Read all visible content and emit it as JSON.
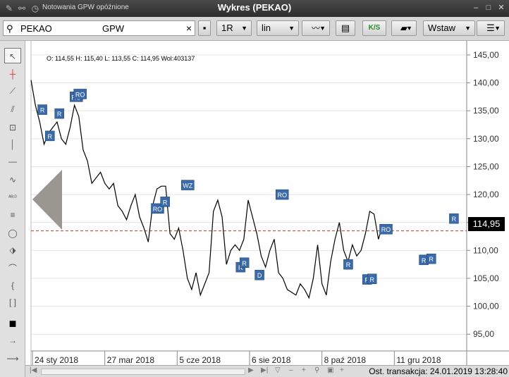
{
  "window": {
    "app_title": "Notowania GPW opóźnione",
    "title": "Wykres (PEKAO)"
  },
  "toolbar": {
    "symbol": "PEKAO",
    "market": "GPW",
    "interval": "1R",
    "scale": "lin",
    "ks_label": "K/S",
    "insert_label": "Wstaw"
  },
  "ohlc_readout": "O: 114,55  H: 115,40  L: 113,55  C: 114,95  Wol:403137",
  "last_price_label": "114,95",
  "status_text": "Ost. transakcja: 24.01.2019 13:28:40",
  "colors": {
    "marker": "#3a6aa8",
    "reference_line": "#c0392b",
    "price_line": "#000000",
    "nav_arrow": "#9a9690"
  },
  "chart_data": {
    "type": "line",
    "y_ticks": [
      "145,00",
      "140,00",
      "135,00",
      "130,00",
      "125,00",
      "120,00",
      "115,00",
      "110,00",
      "105,00",
      "100,00",
      "95,00"
    ],
    "ylim": [
      92,
      146
    ],
    "x_ticks": [
      "24 sty 2018",
      "27 mar 2018",
      "5 cze 2018",
      "6 sie 2018",
      "8 paź 2018",
      "11 gru 2018"
    ],
    "xlim": [
      0,
      100
    ],
    "reference_value": 113.5,
    "last_value": 114.95,
    "x": [
      0,
      1,
      2,
      3,
      4,
      5,
      6,
      7,
      8,
      9,
      10,
      11,
      12,
      13,
      14,
      15,
      16,
      17,
      18,
      19,
      20,
      21,
      22,
      23,
      24,
      25,
      26,
      27,
      28,
      29,
      30,
      31,
      32,
      33,
      34,
      35,
      36,
      37,
      38,
      39,
      40,
      41,
      42,
      43,
      44,
      45,
      46,
      47,
      48,
      49,
      50,
      51,
      52,
      53,
      54,
      55,
      56,
      57,
      58,
      59,
      60,
      61,
      62,
      63,
      64,
      65,
      66,
      67,
      68,
      69,
      70,
      71,
      72,
      73,
      74,
      75,
      76,
      77,
      78,
      79,
      80,
      81,
      82,
      83,
      84,
      85,
      86,
      87,
      88,
      89,
      90,
      91,
      92,
      93,
      94,
      95,
      96,
      97,
      98,
      99
    ],
    "values": [
      140.5,
      136,
      133,
      129,
      131,
      132,
      133,
      130,
      129,
      132,
      136,
      134,
      128,
      126,
      122,
      123,
      124,
      122,
      121,
      122,
      118,
      117,
      115.5,
      118,
      120,
      116,
      114,
      111.5,
      118,
      121,
      121.5,
      121.5,
      113,
      112,
      114,
      110,
      105,
      103,
      106,
      102,
      104,
      106,
      117,
      119,
      116,
      107.5,
      110,
      111,
      110,
      112,
      119,
      116,
      113,
      109,
      107,
      110,
      112,
      106,
      105,
      103,
      102.5,
      102,
      104,
      103,
      101.5,
      105,
      111,
      104,
      102,
      108,
      112,
      115,
      110,
      108,
      111,
      109,
      110,
      113,
      117,
      116.5,
      112,
      114.5
    ]
  },
  "markers": [
    {
      "text": "R",
      "x": 3,
      "y": 135.2
    },
    {
      "text": "R",
      "x": 7.5,
      "y": 134.5
    },
    {
      "text": "RO",
      "x": 12,
      "y": 137.5
    },
    {
      "text": "RO",
      "x": 13,
      "y": 138
    },
    {
      "text": "R",
      "x": 5,
      "y": 130.5
    },
    {
      "text": "RO",
      "x": 33.5,
      "y": 117.5
    },
    {
      "text": "R",
      "x": 35.5,
      "y": 118.7
    },
    {
      "text": "WZ",
      "x": 41.5,
      "y": 121.7
    },
    {
      "text": "R",
      "x": 55.5,
      "y": 107
    },
    {
      "text": "R",
      "x": 56.5,
      "y": 107.8
    },
    {
      "text": "D",
      "x": 60.5,
      "y": 105.6
    },
    {
      "text": "RO",
      "x": 66.5,
      "y": 120
    },
    {
      "text": "R",
      "x": 84,
      "y": 107.5
    },
    {
      "text": "R",
      "x": 89,
      "y": 104.8
    },
    {
      "text": "R",
      "x": 90.3,
      "y": 104.9
    },
    {
      "text": "RO",
      "x": 94,
      "y": 113.8
    },
    {
      "text": "R",
      "x": 104,
      "y": 108.3
    },
    {
      "text": "R",
      "x": 106,
      "y": 108.5
    },
    {
      "text": "R",
      "x": 112,
      "y": 115.7
    }
  ]
}
